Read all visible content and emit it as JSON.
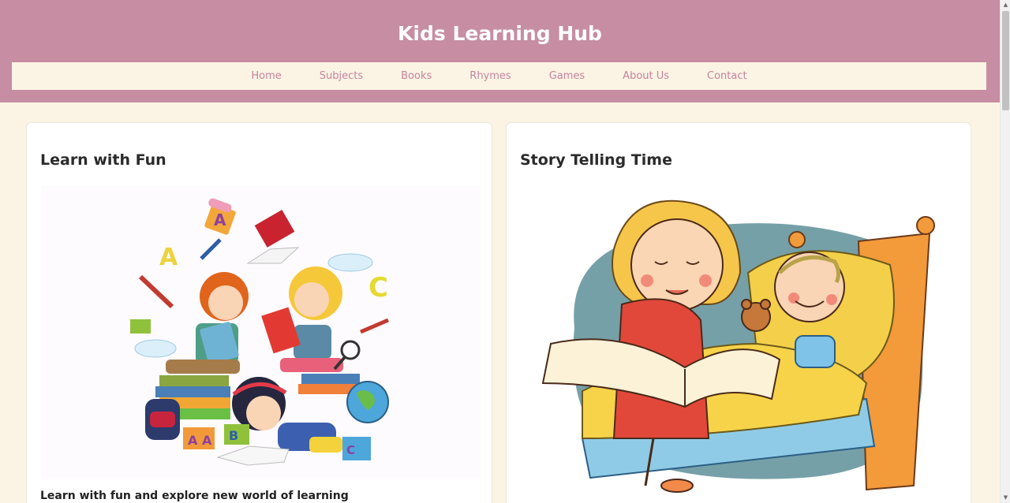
{
  "site": {
    "title": "Kids Learning Hub"
  },
  "nav": {
    "items": [
      "Home",
      "Subjects",
      "Books",
      "Rhymes",
      "Games",
      "About Us",
      "Contact"
    ]
  },
  "cards": [
    {
      "title": "Learn with Fun",
      "caption": "Learn with fun and explore new world of learning",
      "image": "kids-learning-illustration"
    },
    {
      "title": "Story Telling Time",
      "image": "storytelling-illustration"
    }
  ],
  "colors": {
    "header": "#c68da3",
    "page_background": "#fbf4e4",
    "nav_link": "#c6829e"
  }
}
